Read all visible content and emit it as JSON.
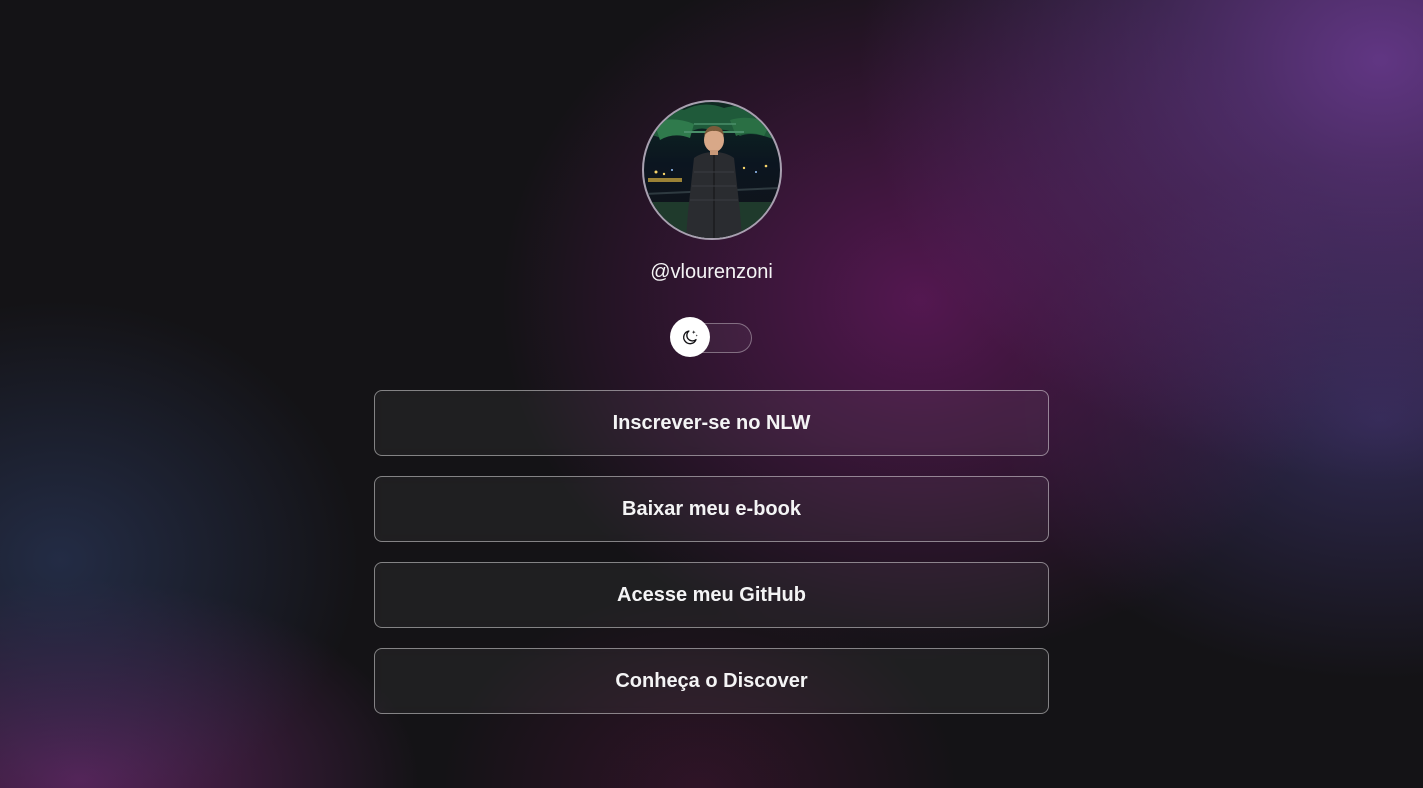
{
  "profile": {
    "username": "@vlourenzoni",
    "avatar_alt": "Foto de perfil"
  },
  "theme_switch": {
    "icon": "moon-stars-icon",
    "state": "dark"
  },
  "links": [
    {
      "label": "Inscrever-se no NLW"
    },
    {
      "label": "Baixar meu e-book"
    },
    {
      "label": "Acesse meu GitHub"
    },
    {
      "label": "Conheça o Discover"
    }
  ],
  "colors": {
    "text": "#F4F4F5",
    "background": "#141316",
    "accent_purple": "#6E3C96",
    "accent_magenta": "#691964"
  }
}
